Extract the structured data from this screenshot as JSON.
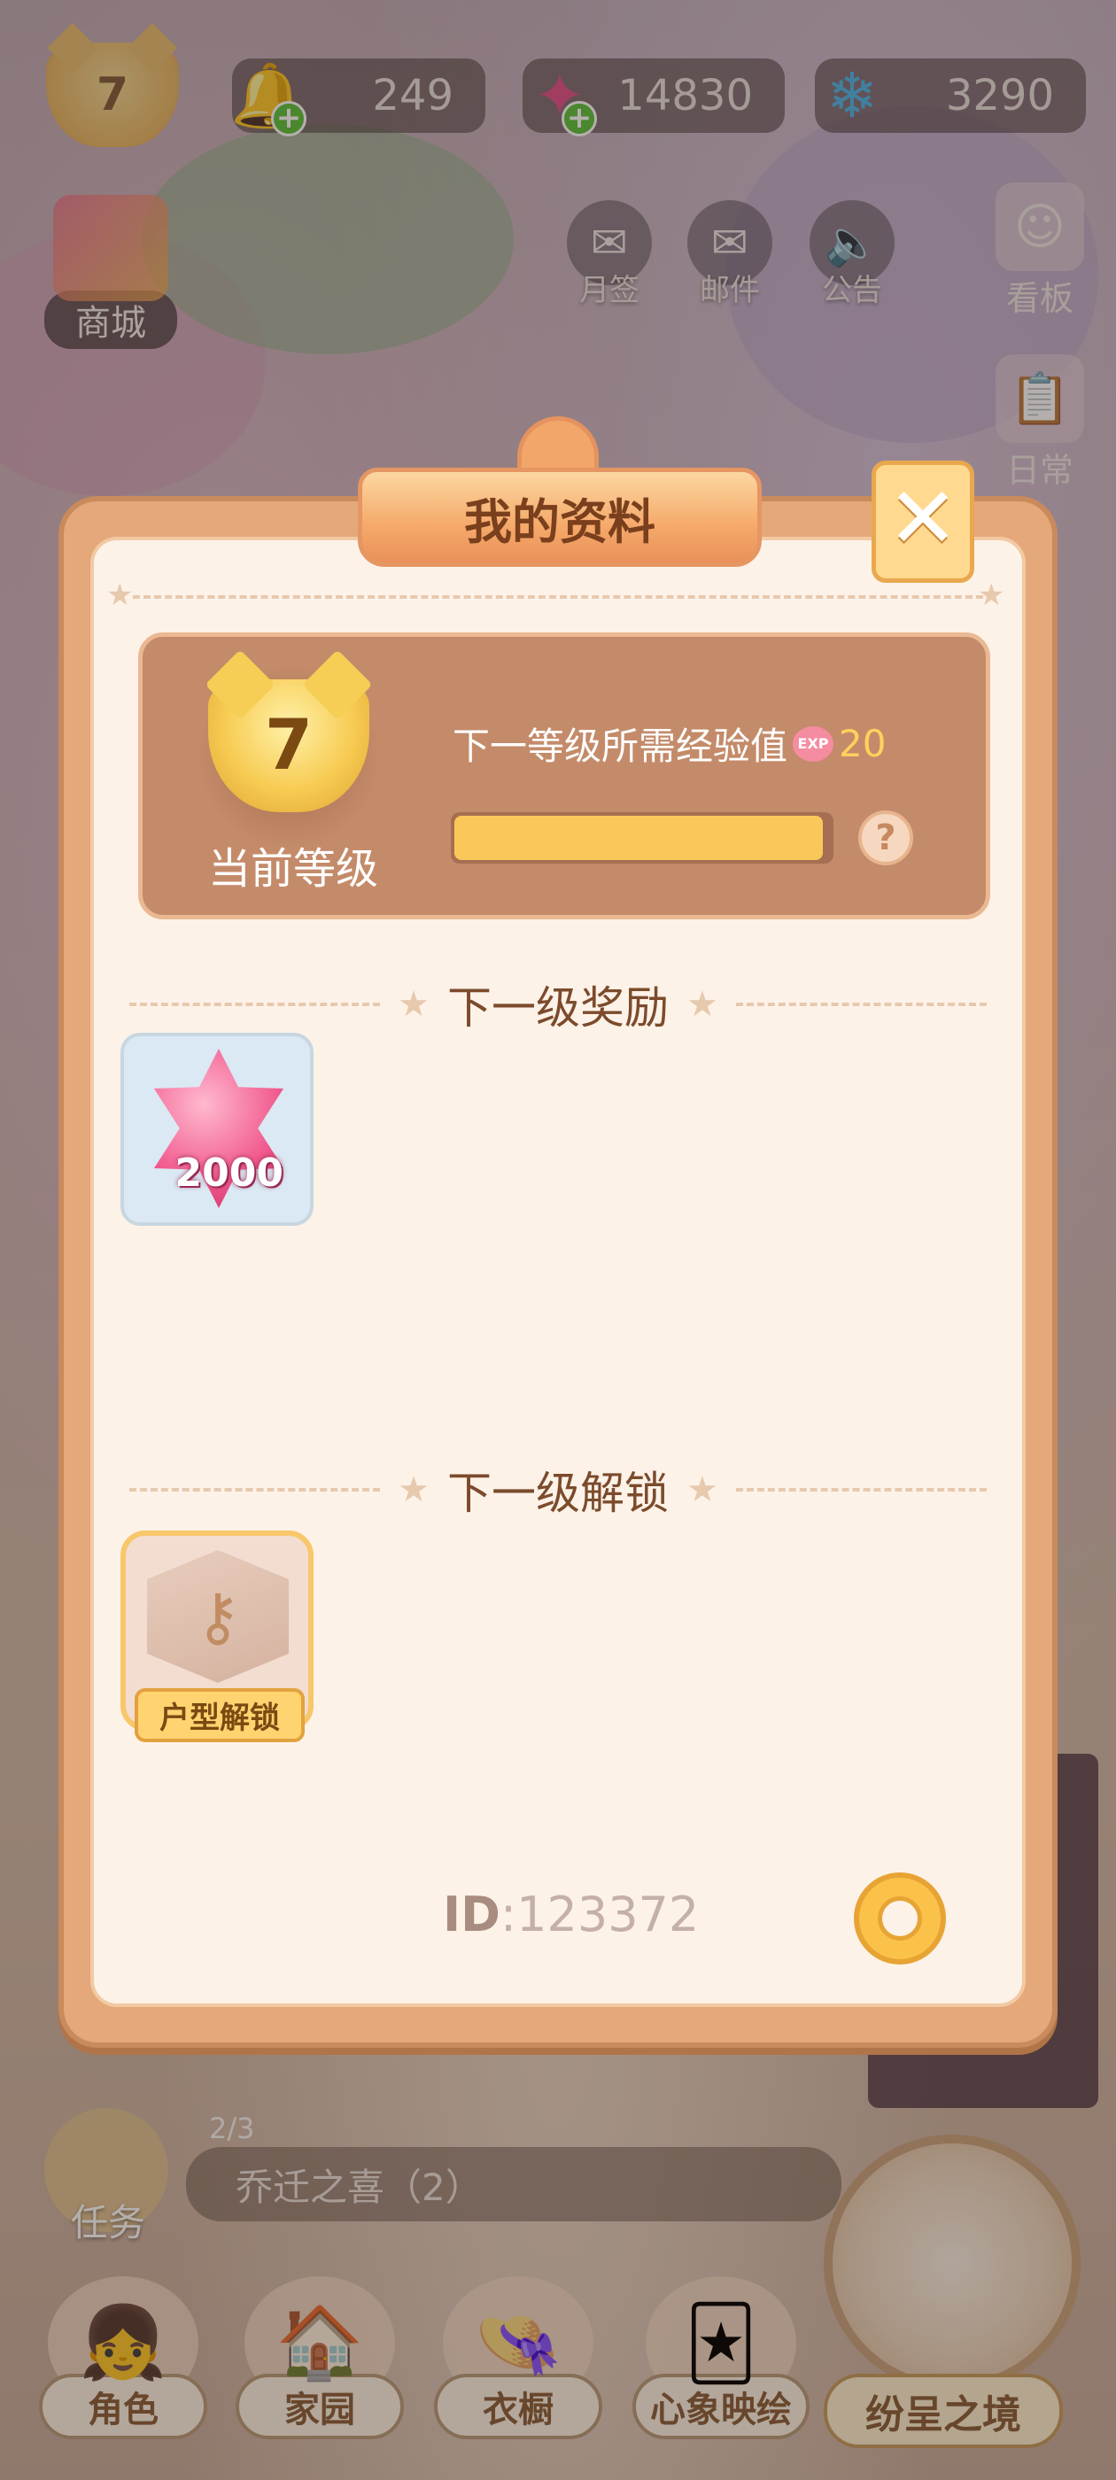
{
  "hud": {
    "player_level": "7",
    "currencies": [
      {
        "icon": "bell-icon",
        "value": "249",
        "has_plus": true
      },
      {
        "icon": "pink-gem-icon",
        "value": "14830",
        "has_plus": true
      },
      {
        "icon": "blue-snowflake-gem-icon",
        "value": "3290",
        "has_plus": false
      }
    ],
    "shop_label": "商城",
    "top_buttons": [
      {
        "icon": "envelope-icon",
        "label": "月签"
      },
      {
        "icon": "mail-icon",
        "label": "邮件"
      },
      {
        "icon": "speaker-icon",
        "label": "公告"
      }
    ],
    "side_buttons": [
      {
        "icon": "character-portrait-icon",
        "label": "看板"
      },
      {
        "icon": "notepad-icon",
        "label": "日常"
      }
    ]
  },
  "modal": {
    "title": "我的资料",
    "current_level": "7",
    "current_level_label": "当前等级",
    "next_exp_label": "下一等级所需经验值",
    "exp_icon_text": "EXP",
    "next_exp_value": "20",
    "exp_progress_fraction": 0.98,
    "help_symbol": "?",
    "reward_section_title": "下一级奖励",
    "rewards": [
      {
        "icon": "pink-gem-icon",
        "amount": "2000"
      }
    ],
    "unlock_section_title": "下一级解锁",
    "unlocks": [
      {
        "icon": "house-key-box-icon",
        "label": "户型解锁"
      }
    ],
    "id_label": "ID",
    "id_value": "123372"
  },
  "task": {
    "label": "任务",
    "progress": "2/3",
    "current": "乔迁之喜（2）"
  },
  "nav": [
    {
      "icon": "character-icon",
      "label": "角色"
    },
    {
      "icon": "house-icon",
      "label": "家园"
    },
    {
      "icon": "hat-icon",
      "label": "衣橱"
    },
    {
      "icon": "cards-icon",
      "label": "心象映绘"
    }
  ],
  "feature": {
    "label": "纷呈之境",
    "icon": "clock-icon"
  },
  "colors": {
    "accent": "#f5a96a",
    "panel": "#fdf2e8",
    "card": "#c48b6a",
    "exp_bar": "#fac85a"
  }
}
